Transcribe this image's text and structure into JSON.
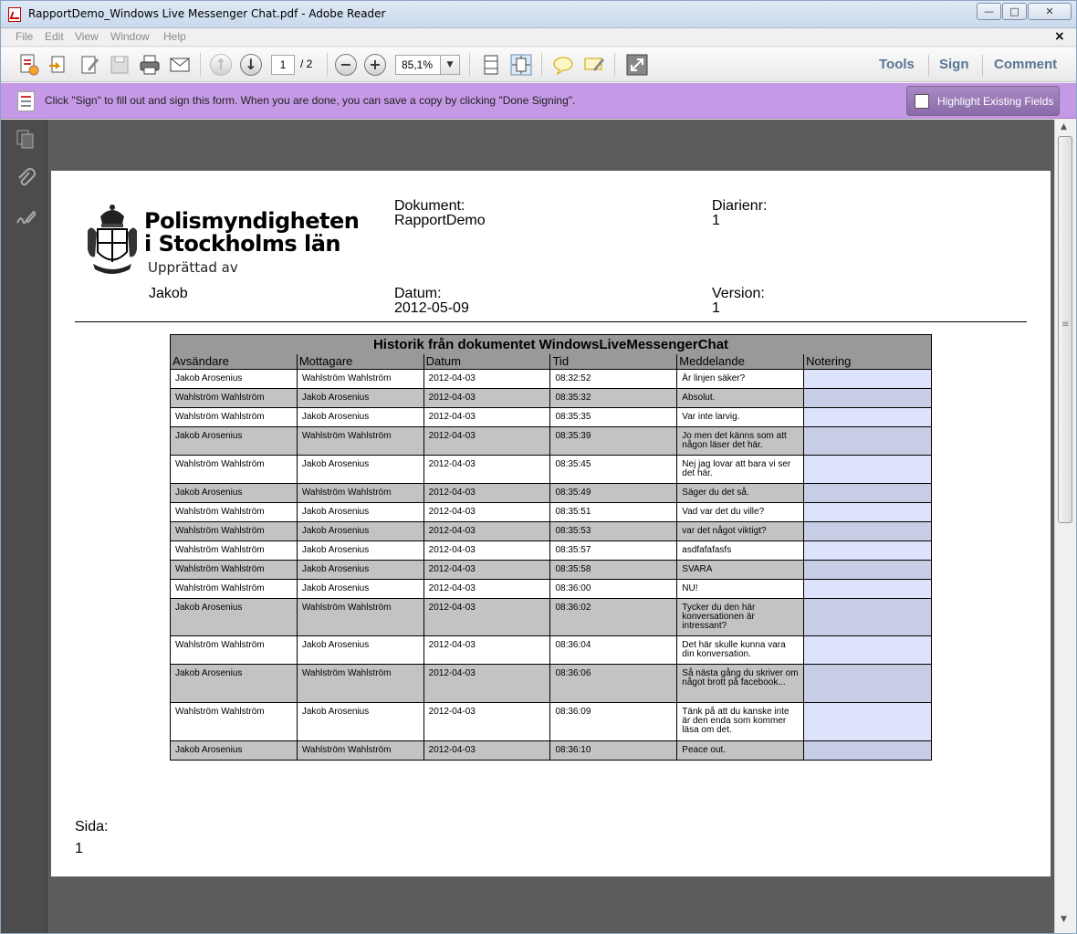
{
  "window": {
    "title": "RapportDemo_Windows Live Messenger Chat.pdf - Adobe Reader",
    "min_glyph": "—",
    "max_glyph": "□",
    "close_glyph": "✕"
  },
  "menu": {
    "items": [
      "File",
      "Edit",
      "View",
      "Window",
      "Help"
    ],
    "doc_close_glyph": "×"
  },
  "toolbar": {
    "current_page": "1",
    "total_pages": "/ 2",
    "zoom": "85,1%",
    "zoom_dropdown_glyph": "▼",
    "prev_glyph": "↑",
    "next_glyph": "↓",
    "zoom_out_glyph": "−",
    "zoom_in_glyph": "+",
    "right_tabs": [
      "Tools",
      "Sign",
      "Comment"
    ]
  },
  "sign_bar": {
    "message": "Click \"Sign\" to fill out and sign this form. When you are done, you can save a copy by clicking \"Done Signing\".",
    "button_label": "Highlight Existing Fields"
  },
  "scrollbar": {
    "up_glyph": "▲",
    "down_glyph": "▼"
  },
  "document": {
    "org_line1": "Polismyndigheten",
    "org_line2": "i Stockholms län",
    "prepared_label": "Upprättad av",
    "prepared_by": "Jakob",
    "dokument_label": "Dokument:",
    "dokument_value": "RapportDemo",
    "diarienr_label": "Diarienr:",
    "diarienr_value": "1",
    "datum_label": "Datum:",
    "datum_value": "2012-05-09",
    "version_label": "Version:",
    "version_value": "1",
    "sida_label": "Sida:",
    "sida_value": "1",
    "table": {
      "caption": "Historik från dokumentet WindowsLiveMessengerChat",
      "headers": [
        "Avsändare",
        "Mottagare",
        "Datum",
        "Tid",
        "Meddelande",
        "Notering"
      ],
      "rows": [
        [
          "Jakob Arosenius",
          "Wahlström Wahlström",
          "2012-04-03",
          "08:32:52",
          "Är linjen säker?",
          ""
        ],
        [
          "Wahlström Wahlström",
          "Jakob Arosenius",
          "2012-04-03",
          "08:35:32",
          "Absolut.",
          ""
        ],
        [
          "Wahlström Wahlström",
          "Jakob Arosenius",
          "2012-04-03",
          "08:35:35",
          "Var inte larvig.",
          ""
        ],
        [
          "Jakob Arosenius",
          "Wahlström Wahlström",
          "2012-04-03",
          "08:35:39",
          "Jo men det känns som att någon läser det här.",
          ""
        ],
        [
          "Wahlström Wahlström",
          "Jakob Arosenius",
          "2012-04-03",
          "08:35:45",
          "Nej jag lovar att bara vi ser det här.",
          ""
        ],
        [
          "Jakob Arosenius",
          "Wahlström Wahlström",
          "2012-04-03",
          "08:35:49",
          "Säger du det så.",
          ""
        ],
        [
          "Wahlström Wahlström",
          "Jakob Arosenius",
          "2012-04-03",
          "08:35:51",
          "Vad var det du ville?",
          ""
        ],
        [
          "Wahlström Wahlström",
          "Jakob Arosenius",
          "2012-04-03",
          "08:35:53",
          "var det något viktigt?",
          ""
        ],
        [
          "Wahlström Wahlström",
          "Jakob Arosenius",
          "2012-04-03",
          "08:35:57",
          "asdfafafasfs",
          ""
        ],
        [
          "Wahlström Wahlström",
          "Jakob Arosenius",
          "2012-04-03",
          "08:35:58",
          "SVARA",
          ""
        ],
        [
          "Wahlström Wahlström",
          "Jakob Arosenius",
          "2012-04-03",
          "08:36:00",
          "NU!",
          ""
        ],
        [
          "Jakob Arosenius",
          "Wahlström Wahlström",
          "2012-04-03",
          "08:36:02",
          "Tycker du den här konversationen är intressant?",
          ""
        ],
        [
          "Wahlström Wahlström",
          "Jakob Arosenius",
          "2012-04-03",
          "08:36:04",
          "Det här skulle kunna vara din konversation.",
          ""
        ],
        [
          "Jakob Arosenius",
          "Wahlström Wahlström",
          "2012-04-03",
          "08:36:06",
          "Så nästa gång du skriver om något brott på facebook...",
          ""
        ],
        [
          "Wahlström Wahlström",
          "Jakob Arosenius",
          "2012-04-03",
          "08:36:09",
          "Tänk på att du kanske inte är den enda som kommer läsa om det.",
          ""
        ],
        [
          "Jakob Arosenius",
          "Wahlström Wahlström",
          "2012-04-03",
          "08:36:10",
          "Peace out.",
          ""
        ]
      ]
    }
  },
  "colors": {
    "sign_bar": "#c699e6",
    "right_tab_text": "#5a7594",
    "note_column": "#dde3fb",
    "table_header": "#999999"
  }
}
